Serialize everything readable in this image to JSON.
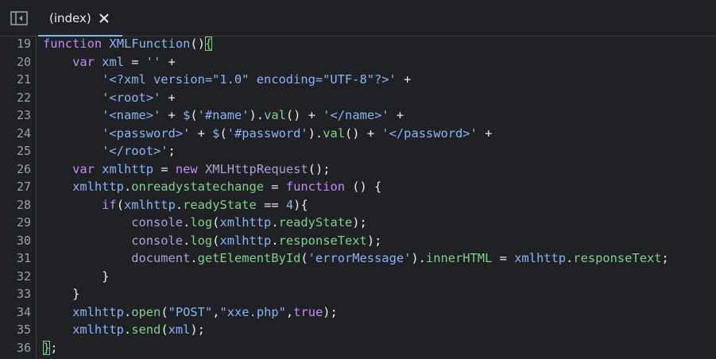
{
  "tab": {
    "label": "(index)",
    "close_icon": "close-icon",
    "sidebar_icon": "sidebar-toggle-icon",
    "accent": "#8ab4f8"
  },
  "editor": {
    "lines": [
      {
        "number": "19",
        "tokens": [
          {
            "t": "function",
            "c": "keyword"
          },
          {
            "t": " ",
            "c": "punct"
          },
          {
            "t": "XMLFunction",
            "c": "def"
          },
          {
            "t": "()",
            "c": "punct"
          },
          {
            "t": "{",
            "c": "bracket-match"
          }
        ]
      },
      {
        "number": "20",
        "tokens": [
          {
            "t": "    ",
            "c": "punct"
          },
          {
            "t": "var",
            "c": "keyword"
          },
          {
            "t": " ",
            "c": "punct"
          },
          {
            "t": "xml",
            "c": "def"
          },
          {
            "t": " = ",
            "c": "op"
          },
          {
            "t": "''",
            "c": "string"
          },
          {
            "t": " +",
            "c": "op"
          }
        ]
      },
      {
        "number": "21",
        "tokens": [
          {
            "t": "        ",
            "c": "punct"
          },
          {
            "t": "'<?xml version=\"1.0\" encoding=\"UTF-8\"?>'",
            "c": "string"
          },
          {
            "t": " +",
            "c": "op"
          }
        ]
      },
      {
        "number": "22",
        "tokens": [
          {
            "t": "        ",
            "c": "punct"
          },
          {
            "t": "'<root>'",
            "c": "string"
          },
          {
            "t": " +",
            "c": "op"
          }
        ]
      },
      {
        "number": "23",
        "tokens": [
          {
            "t": "        ",
            "c": "punct"
          },
          {
            "t": "'<name>'",
            "c": "string"
          },
          {
            "t": " + ",
            "c": "op"
          },
          {
            "t": "$",
            "c": "var"
          },
          {
            "t": "(",
            "c": "punct"
          },
          {
            "t": "'#name'",
            "c": "string"
          },
          {
            "t": ").",
            "c": "punct"
          },
          {
            "t": "val",
            "c": "prop"
          },
          {
            "t": "()",
            "c": "punct"
          },
          {
            "t": " + ",
            "c": "op"
          },
          {
            "t": "'</name>'",
            "c": "string"
          },
          {
            "t": " +",
            "c": "op"
          }
        ]
      },
      {
        "number": "24",
        "tokens": [
          {
            "t": "        ",
            "c": "punct"
          },
          {
            "t": "'<password>'",
            "c": "string"
          },
          {
            "t": " + ",
            "c": "op"
          },
          {
            "t": "$",
            "c": "var"
          },
          {
            "t": "(",
            "c": "punct"
          },
          {
            "t": "'#password'",
            "c": "string"
          },
          {
            "t": ").",
            "c": "punct"
          },
          {
            "t": "val",
            "c": "prop"
          },
          {
            "t": "()",
            "c": "punct"
          },
          {
            "t": " + ",
            "c": "op"
          },
          {
            "t": "'</password>'",
            "c": "string"
          },
          {
            "t": " +",
            "c": "op"
          }
        ]
      },
      {
        "number": "25",
        "tokens": [
          {
            "t": "        ",
            "c": "punct"
          },
          {
            "t": "'</root>'",
            "c": "string"
          },
          {
            "t": ";",
            "c": "punct"
          }
        ]
      },
      {
        "number": "26",
        "tokens": [
          {
            "t": "    ",
            "c": "punct"
          },
          {
            "t": "var",
            "c": "keyword"
          },
          {
            "t": " ",
            "c": "punct"
          },
          {
            "t": "xmlhttp",
            "c": "def"
          },
          {
            "t": " = ",
            "c": "op"
          },
          {
            "t": "new",
            "c": "keyword"
          },
          {
            "t": " ",
            "c": "punct"
          },
          {
            "t": "XMLHttpRequest",
            "c": "name"
          },
          {
            "t": "();",
            "c": "punct"
          }
        ]
      },
      {
        "number": "27",
        "tokens": [
          {
            "t": "    ",
            "c": "punct"
          },
          {
            "t": "xmlhttp",
            "c": "var"
          },
          {
            "t": ".",
            "c": "punct"
          },
          {
            "t": "onreadystatechange",
            "c": "prop"
          },
          {
            "t": " = ",
            "c": "op"
          },
          {
            "t": "function",
            "c": "keyword"
          },
          {
            "t": " () {",
            "c": "punct"
          }
        ]
      },
      {
        "number": "28",
        "tokens": [
          {
            "t": "        ",
            "c": "punct"
          },
          {
            "t": "if",
            "c": "keyword"
          },
          {
            "t": "(",
            "c": "punct"
          },
          {
            "t": "xmlhttp",
            "c": "var"
          },
          {
            "t": ".",
            "c": "punct"
          },
          {
            "t": "readyState",
            "c": "prop"
          },
          {
            "t": " == ",
            "c": "op"
          },
          {
            "t": "4",
            "c": "number"
          },
          {
            "t": "){",
            "c": "punct"
          }
        ]
      },
      {
        "number": "29",
        "tokens": [
          {
            "t": "            ",
            "c": "punct"
          },
          {
            "t": "console",
            "c": "name"
          },
          {
            "t": ".",
            "c": "punct"
          },
          {
            "t": "log",
            "c": "prop"
          },
          {
            "t": "(",
            "c": "punct"
          },
          {
            "t": "xmlhttp",
            "c": "var"
          },
          {
            "t": ".",
            "c": "punct"
          },
          {
            "t": "readyState",
            "c": "prop"
          },
          {
            "t": ");",
            "c": "punct"
          }
        ]
      },
      {
        "number": "30",
        "tokens": [
          {
            "t": "            ",
            "c": "punct"
          },
          {
            "t": "console",
            "c": "name"
          },
          {
            "t": ".",
            "c": "punct"
          },
          {
            "t": "log",
            "c": "prop"
          },
          {
            "t": "(",
            "c": "punct"
          },
          {
            "t": "xmlhttp",
            "c": "var"
          },
          {
            "t": ".",
            "c": "punct"
          },
          {
            "t": "responseText",
            "c": "prop"
          },
          {
            "t": ");",
            "c": "punct"
          }
        ]
      },
      {
        "number": "31",
        "tokens": [
          {
            "t": "            ",
            "c": "punct"
          },
          {
            "t": "document",
            "c": "name"
          },
          {
            "t": ".",
            "c": "punct"
          },
          {
            "t": "getElementById",
            "c": "prop"
          },
          {
            "t": "(",
            "c": "punct"
          },
          {
            "t": "'errorMessage'",
            "c": "string"
          },
          {
            "t": ").",
            "c": "punct"
          },
          {
            "t": "innerHTML",
            "c": "prop"
          },
          {
            "t": " = ",
            "c": "op"
          },
          {
            "t": "xmlhttp",
            "c": "var"
          },
          {
            "t": ".",
            "c": "punct"
          },
          {
            "t": "responseText",
            "c": "prop"
          },
          {
            "t": ";",
            "c": "punct"
          }
        ]
      },
      {
        "number": "32",
        "tokens": [
          {
            "t": "        }",
            "c": "punct"
          }
        ]
      },
      {
        "number": "33",
        "tokens": [
          {
            "t": "    }",
            "c": "punct"
          }
        ]
      },
      {
        "number": "34",
        "tokens": [
          {
            "t": "    ",
            "c": "punct"
          },
          {
            "t": "xmlhttp",
            "c": "var"
          },
          {
            "t": ".",
            "c": "punct"
          },
          {
            "t": "open",
            "c": "prop"
          },
          {
            "t": "(",
            "c": "punct"
          },
          {
            "t": "\"POST\"",
            "c": "string"
          },
          {
            "t": ",",
            "c": "punct"
          },
          {
            "t": "\"xxe.php\"",
            "c": "string"
          },
          {
            "t": ",",
            "c": "punct"
          },
          {
            "t": "true",
            "c": "keyword"
          },
          {
            "t": ");",
            "c": "punct"
          }
        ]
      },
      {
        "number": "35",
        "tokens": [
          {
            "t": "    ",
            "c": "punct"
          },
          {
            "t": "xmlhttp",
            "c": "var"
          },
          {
            "t": ".",
            "c": "punct"
          },
          {
            "t": "send",
            "c": "prop"
          },
          {
            "t": "(",
            "c": "punct"
          },
          {
            "t": "xml",
            "c": "var"
          },
          {
            "t": ");",
            "c": "punct"
          }
        ]
      },
      {
        "number": "36",
        "tokens": [
          {
            "t": "}",
            "c": "bracket-match"
          },
          {
            "t": ";",
            "c": "punct"
          }
        ]
      }
    ]
  }
}
